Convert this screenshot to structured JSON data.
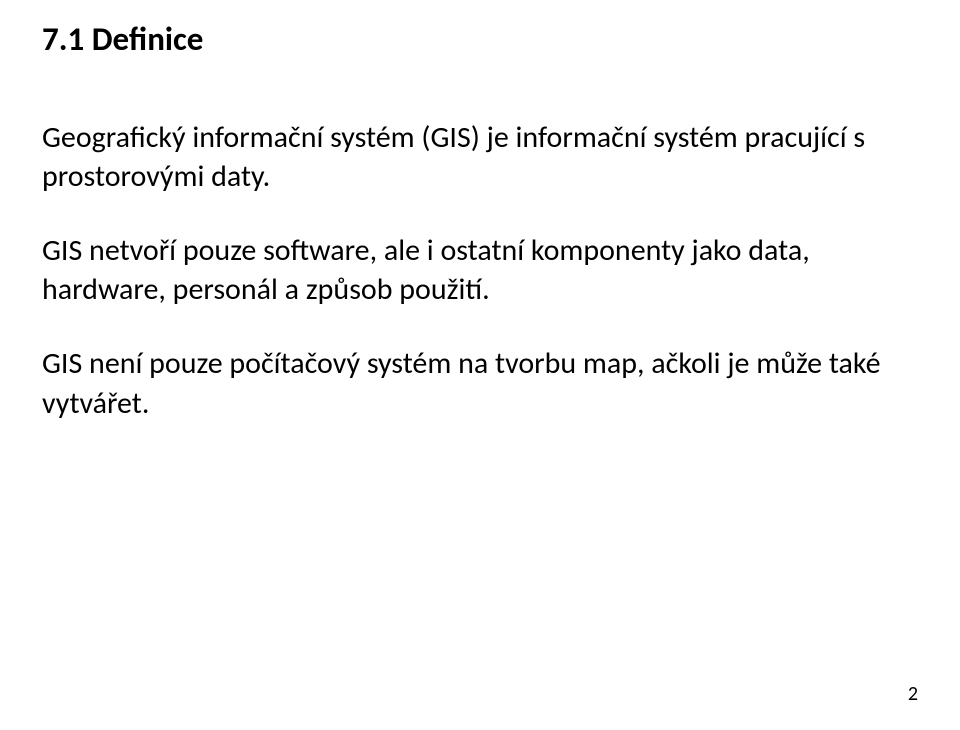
{
  "heading": "7.1 Definice",
  "paragraphs": [
    "Geografický informační systém (GIS) je informační systém pracující s prostorovými daty.",
    "GIS netvoří pouze software, ale i ostatní komponenty jako data, hardware, personál a způsob použití.",
    "GIS není pouze počítačový systém na tvorbu map, ačkoli je může také vytvářet."
  ],
  "page_number": "2"
}
